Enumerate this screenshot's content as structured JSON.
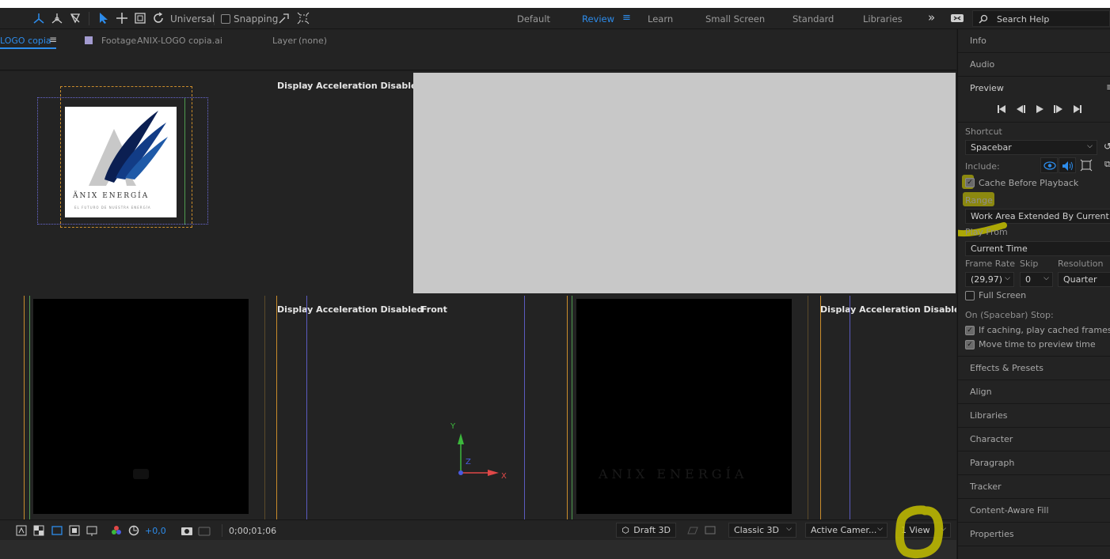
{
  "toolbar": {
    "universal_label": "Universal",
    "snapping_label": "Snapping",
    "workspaces": [
      "Default",
      "Review",
      "Learn",
      "Small Screen",
      "Standard",
      "Libraries"
    ],
    "active_workspace": "Review",
    "more_label": "»",
    "search_placeholder": "Search Help"
  },
  "viewer_header": {
    "comp_tab": "LOGO copia",
    "footage_label": "Footage",
    "footage_name": "ANIX-LOGO copia.ai",
    "layer_label": "Layer",
    "layer_value": "(none)"
  },
  "viewer": {
    "display_accel_1": "Display Acceleration Disabled",
    "display_accel_2": "Display Acceleration Disabled",
    "display_accel_3": "Display Acceleration Disabled",
    "front_label": "Front",
    "logo_text": "ÄNIX ENERGÍA",
    "logo_tagline": "EL FUTURO DE NUESTRA ENERGÍA",
    "faded_logo_text": "ANIX ENERGÍA",
    "axis_y": "Y",
    "axis_z": "Z",
    "axis_x": "X"
  },
  "bottombar": {
    "exposure_value": "+0,0",
    "timecode": "0;00;01;06",
    "draft_3d": "Draft 3D",
    "renderer": "Classic 3D",
    "camera": "Active Camer...",
    "views": "1 View"
  },
  "right_panel": {
    "info": "Info",
    "audio": "Audio",
    "preview": "Preview",
    "shortcut_label": "Shortcut",
    "shortcut_value": "Spacebar",
    "include_label": "Include:",
    "cache_before_playback": "Cache Before Playback",
    "range_label": "Range",
    "range_value": "Work Area Extended By Current...",
    "play_from_label": "Play From",
    "play_from_value": "Current Time",
    "frame_rate_label": "Frame Rate",
    "skip_label": "Skip",
    "resolution_label": "Resolution",
    "frame_rate_value": "(29,97)",
    "skip_value": "0",
    "resolution_value": "Quarter",
    "full_screen": "Full Screen",
    "on_stop_label": "On (Spacebar) Stop:",
    "if_caching": "If caching, play cached frames",
    "move_time": "Move time to preview time",
    "effects_presets": "Effects & Presets",
    "align": "Align",
    "libraries": "Libraries",
    "character": "Character",
    "paragraph": "Paragraph",
    "tracker": "Tracker",
    "content_aware_fill": "Content-Aware Fill",
    "properties": "Properties"
  },
  "colors": {
    "accent": "#2d8ceb",
    "highlight": "#e1dc00",
    "panel_bg": "#232323",
    "gray_view": "#c8c8c8"
  }
}
